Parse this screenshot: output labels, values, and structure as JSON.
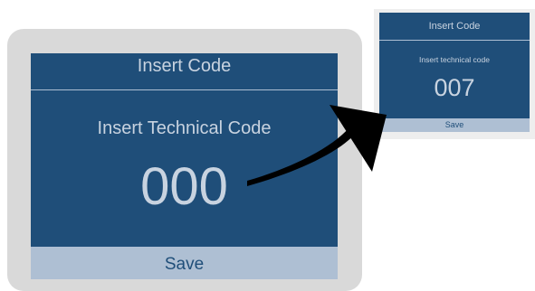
{
  "before": {
    "title": "Insert Code",
    "prompt": "Insert Technical Code",
    "code": "000",
    "save_label": "Save"
  },
  "after": {
    "title": "Insert Code",
    "prompt": "Insert technical code",
    "code": "007",
    "save_label": "Save"
  },
  "arrow_icon": "curved-arrow-right-icon",
  "colors": {
    "screen_bg": "#1f4e79",
    "screen_text": "#c8d3e0",
    "save_bar_bg": "#aebfd3",
    "save_bar_text": "#1f4e79",
    "device_frame": "#d9d9d9",
    "arrow": "#000000"
  }
}
